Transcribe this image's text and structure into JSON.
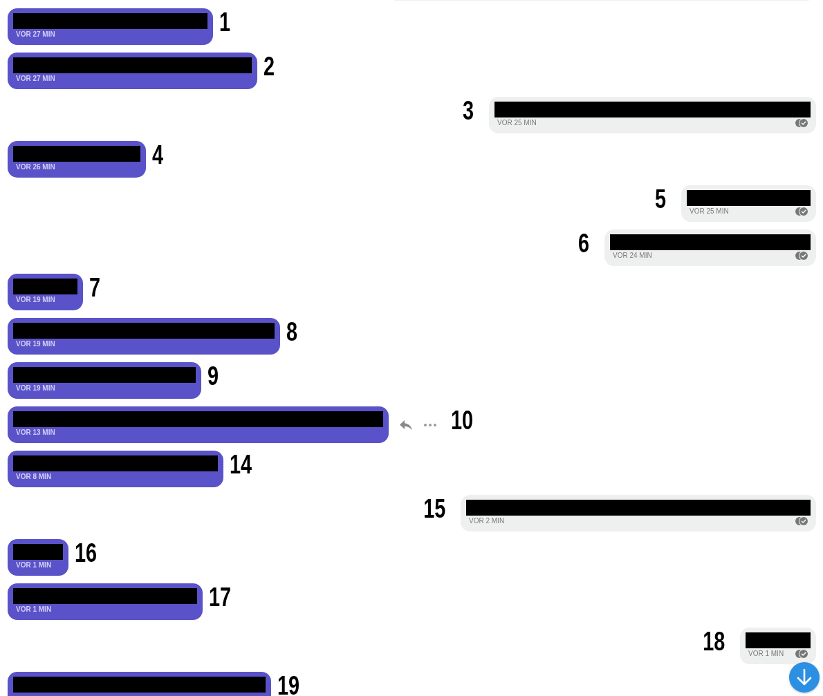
{
  "messages": [
    {
      "kind": "outgoing"
    },
    {
      "kind": "incoming",
      "redacted": true,
      "time": "VOR 27 MIN",
      "annotation": "1",
      "actions_visible": false
    },
    {
      "kind": "incoming",
      "redacted": true,
      "time": "VOR 27 MIN",
      "annotation": "2",
      "actions_visible": false
    },
    {
      "kind": "outgoing",
      "redacted": true,
      "time": "VOR 25 MIN",
      "read": true,
      "annotation": "3",
      "actions_visible": false
    },
    {
      "kind": "incoming",
      "redacted": true,
      "time": "VOR 26 MIN",
      "annotation": "4",
      "actions_visible": false
    },
    {
      "kind": "outgoing",
      "redacted": true,
      "time": "VOR 25 MIN",
      "read": true,
      "annotation": "5",
      "actions_visible": false
    },
    {
      "kind": "outgoing",
      "redacted": true,
      "time": "VOR 24 MIN",
      "read": true,
      "annotation": "6",
      "actions_visible": false
    },
    {
      "kind": "incoming",
      "redacted": true,
      "time": "VOR 19 MIN",
      "annotation": "7",
      "actions_visible": false
    },
    {
      "kind": "incoming",
      "redacted": true,
      "time": "VOR 19 MIN",
      "annotation": "8",
      "actions_visible": false
    },
    {
      "kind": "incoming",
      "redacted": true,
      "time": "VOR 19 MIN",
      "annotation": "9",
      "actions_visible": false
    },
    {
      "kind": "incoming",
      "redacted": true,
      "time": "VOR 13 MIN",
      "annotation": "10",
      "actions_visible": true
    },
    {
      "kind": "incoming",
      "redacted": true,
      "time": "VOR 8 MIN",
      "annotation": "14",
      "actions_visible": false
    },
    {
      "kind": "outgoing",
      "redacted": true,
      "time": "VOR 2 MIN",
      "read": true,
      "annotation": "15",
      "actions_visible": false
    },
    {
      "kind": "incoming",
      "redacted": true,
      "time": "VOR 1 MIN",
      "annotation": "16",
      "actions_visible": false
    },
    {
      "kind": "incoming",
      "redacted": true,
      "time": "VOR 1 MIN",
      "annotation": "17",
      "actions_visible": false
    },
    {
      "kind": "outgoing",
      "redacted": true,
      "time": "VOR 1 MIN",
      "read": true,
      "annotation": "18",
      "actions_visible": false
    },
    {
      "kind": "incoming",
      "redacted": true,
      "annotation": "19",
      "actions_visible": false
    }
  ]
}
